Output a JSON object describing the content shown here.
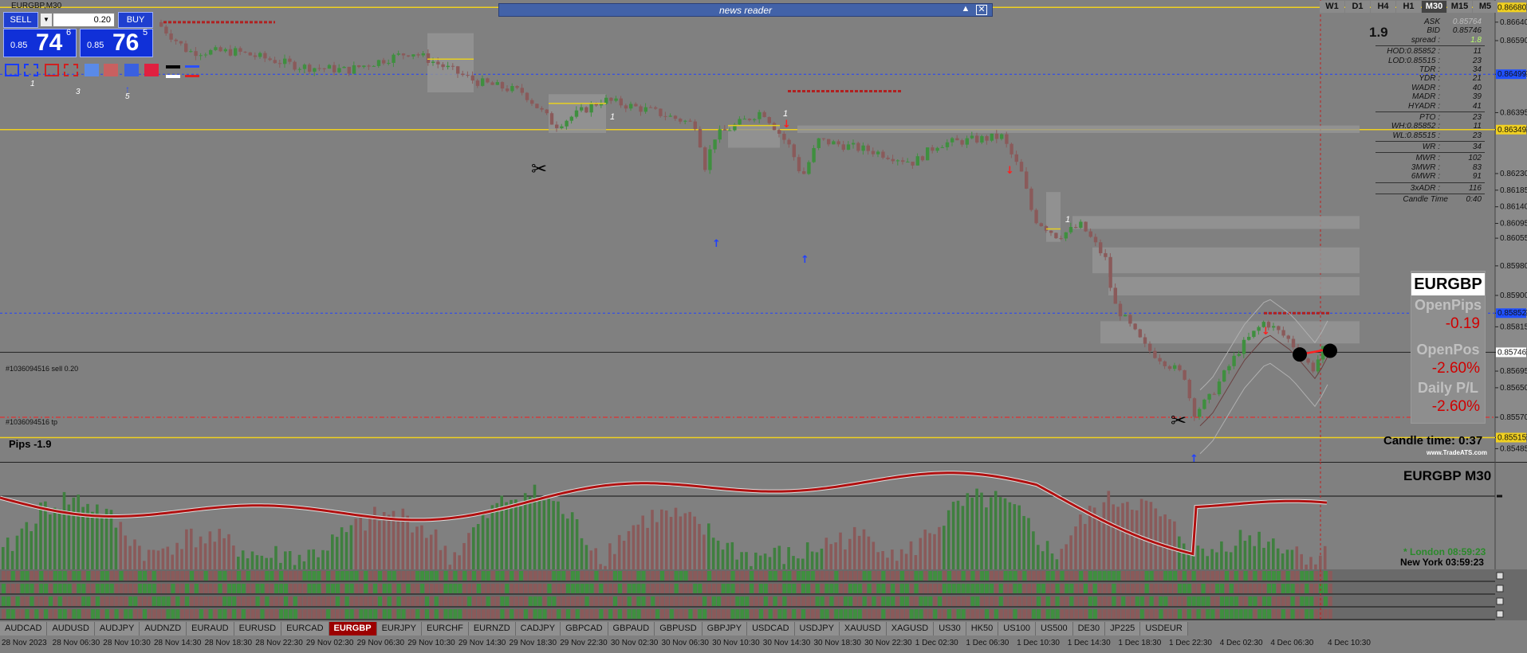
{
  "window": {
    "title": "EURGBP,M30"
  },
  "trade_panel": {
    "sell_label": "SELL",
    "buy_label": "BUY",
    "lot": "0.20",
    "bid_small": "0.85",
    "bid_big": "74",
    "bid_sup": "6",
    "ask_small": "0.85",
    "ask_big": "76",
    "ask_sup": "5",
    "tool_numbers": [
      "1",
      "3",
      "5"
    ]
  },
  "news_bar": {
    "title": "news reader",
    "up": "▲",
    "close": "✕"
  },
  "timeframes": [
    "W1",
    "D1",
    "H4",
    "H1",
    "M30",
    "M15",
    "M5"
  ],
  "active_timeframe": "M30",
  "spread_big": "1.9",
  "info_rows": [
    {
      "k": "ASK",
      "v": "0.85764"
    },
    {
      "k": "BID",
      "v": "0.85746"
    },
    {
      "k": "spread :",
      "v": "1.8"
    },
    {
      "k": "HOD:0.85852 :",
      "v": "11"
    },
    {
      "k": "LOD:0.85515 :",
      "v": "23"
    },
    {
      "k": "TDR :",
      "v": "34"
    },
    {
      "k": "YDR :",
      "v": "21"
    },
    {
      "k": "WADR :",
      "v": "40"
    },
    {
      "k": "MADR :",
      "v": "39"
    },
    {
      "k": "HYADR :",
      "v": "41"
    },
    {
      "k": "PTO :",
      "v": "23"
    },
    {
      "k": "WH:0.85852 :",
      "v": "11"
    },
    {
      "k": "WL:0.85515 :",
      "v": "23"
    },
    {
      "k": "WR :",
      "v": "34"
    },
    {
      "k": "MWR :",
      "v": "102"
    },
    {
      "k": "3MWR :",
      "v": "83"
    },
    {
      "k": "6MWR :",
      "v": "91"
    },
    {
      "k": "3xADR :",
      "v": "116"
    },
    {
      "k": "Candle Time",
      "v": "0:40"
    }
  ],
  "account": {
    "symbol": "EURGBP",
    "open_pips_label": "OpenPips",
    "open_pips": "-0.19",
    "open_pos_label": "OpenPos",
    "open_pos": "-2.60%",
    "daily_label": "Daily P/L",
    "daily": "-2.60%"
  },
  "candle_time": "Candle time:  0:37",
  "pips_label": "Pips -1.9",
  "order_line_1": "#1036094516 sell 0.20",
  "order_line_2": "#1036094516 tp",
  "brand": "www.TradeATS.com",
  "osc_title": "EURGBP  M30",
  "clocks": {
    "london": "* London   08:59:23",
    "new_york": "New York   03:59:23"
  },
  "price_axis": [
    "0.86680",
    "0.86640",
    "0.86590",
    "0.86499",
    "0.86395",
    "0.86349",
    "0.86230",
    "0.86185",
    "0.86140",
    "0.86095",
    "0.86055",
    "0.85980",
    "0.85900",
    "0.85852",
    "0.85815",
    "0.85746",
    "0.85695",
    "0.85650",
    "0.85570",
    "0.85515",
    "0.85485"
  ],
  "price_axis_badges": {
    "top": {
      "text": "0.86680",
      "color": "#f0d020"
    },
    "blue1": {
      "text": "0.86499",
      "color": "#2050ff"
    },
    "yellow": {
      "text": "0.86349",
      "color": "#f0d020"
    },
    "blue2": {
      "text": "0.85852",
      "color": "#2050ff"
    },
    "current": {
      "text": "0.85746",
      "color": "#ffffff"
    },
    "low": {
      "text": "0.85515",
      "color": "#f0d020"
    }
  },
  "symbol_tabs": [
    "AUDCAD",
    "AUDUSD",
    "AUDJPY",
    "AUDNZD",
    "EURAUD",
    "EURUSD",
    "EURCAD",
    "EURGBP",
    "EURJPY",
    "EURCHF",
    "EURNZD",
    "CADJPY",
    "GBPCAD",
    "GBPAUD",
    "GBPUSD",
    "GBPJPY",
    "USDCAD",
    "USDJPY",
    "XAUUSD",
    "XAGUSD",
    "US30",
    "HK50",
    "US100",
    "US500",
    "DE30",
    "JP225",
    "USDEUR"
  ],
  "active_symbol": "EURGBP",
  "time_axis": [
    "28 Nov 2023",
    "28 Nov 06:30",
    "28 Nov 10:30",
    "28 Nov 14:30",
    "28 Nov 18:30",
    "28 Nov 22:30",
    "29 Nov 02:30",
    "29 Nov 06:30",
    "29 Nov 10:30",
    "29 Nov 14:30",
    "29 Nov 18:30",
    "29 Nov 22:30",
    "30 Nov 02:30",
    "30 Nov 06:30",
    "30 Nov 10:30",
    "30 Nov 14:30",
    "30 Nov 18:30",
    "30 Nov 22:30",
    "1 Dec 02:30",
    "1 Dec 06:30",
    "1 Dec 10:30",
    "1 Dec 14:30",
    "1 Dec 18:30",
    "1 Dec 22:30",
    "4 Dec 02:30",
    "4 Dec 06:30",
    "4 Dec 10:30"
  ],
  "chart_labels": [
    "1",
    "1",
    "1"
  ],
  "colors": {
    "bull": "#3f8f3f",
    "bear": "#8a5a5a",
    "background": "#808080",
    "level": "#f0d020",
    "blue_level": "#2040ff"
  }
}
